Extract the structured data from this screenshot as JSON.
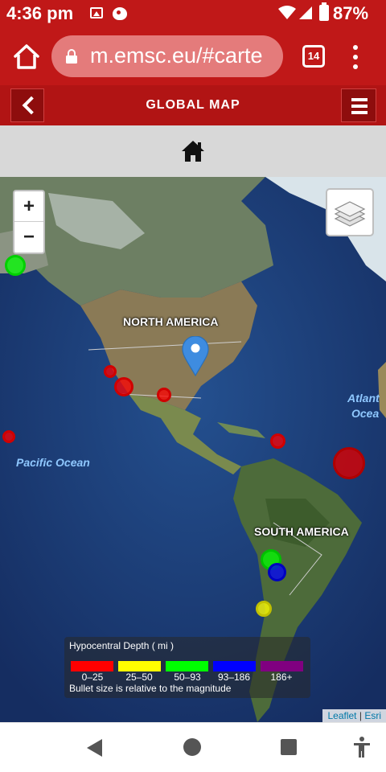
{
  "status_bar": {
    "time": "4:36 pm",
    "battery": "87%",
    "icons": [
      "gallery-icon",
      "notification-icon",
      "wifi-icon",
      "signal-icon",
      "battery-icon"
    ]
  },
  "browser": {
    "url": "m.emsc.eu/#carte",
    "tab_count": "14",
    "icons": [
      "home-icon",
      "lock-icon",
      "tabs-icon",
      "more-vert-icon"
    ]
  },
  "header": {
    "title": "GLOBAL MAP",
    "back_icon": "chevron-left-icon",
    "menu_icon": "hamburger-icon"
  },
  "home_strip": {
    "icon": "house-icon"
  },
  "map": {
    "zoom_in": "+",
    "zoom_out": "−",
    "labels": {
      "north_america": "NORTH AMERICA",
      "south_america": "SOUTH AMERICA",
      "pacific": "Pacific Ocean",
      "atlantic_1": "Atlant",
      "atlantic_2": "Ocea"
    },
    "quake_colors": {
      "shallow": "#ff0000",
      "mid": "#ffff00",
      "intermediate": "#00ff00",
      "deep": "#0000ff",
      "very_deep": "#800080"
    },
    "attribution": {
      "leaflet": "Leaflet",
      "separator": "|",
      "esri": "Esri"
    }
  },
  "legend": {
    "title": "Hypocentral Depth ( mi )",
    "ranges": [
      {
        "label": "0–25",
        "color": "#ff0000"
      },
      {
        "label": "25–50",
        "color": "#ffff00"
      },
      {
        "label": "50–93",
        "color": "#00ff00"
      },
      {
        "label": "93–186",
        "color": "#0000ff"
      },
      {
        "label": "186+",
        "color": "#800080"
      }
    ],
    "note": "Bullet size is relative to the magnitude"
  }
}
